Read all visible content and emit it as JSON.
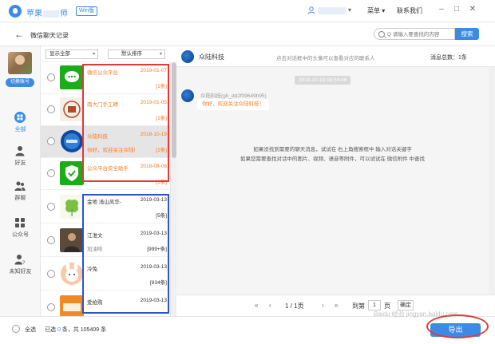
{
  "titlebar": {
    "app_name": "苹果",
    "app_name_suffix": "师",
    "edition": "Win版",
    "user_name": "",
    "menu_label": "菜单 ▾",
    "contact_label": "联系我们",
    "minimize": "–",
    "restore": "□",
    "close": "✕"
  },
  "header": {
    "title": "微信聊天记录",
    "search_placeholder": "Q 请输入要查找的内容",
    "search_button": "搜索"
  },
  "sidebar": {
    "switch_account": "切换账号",
    "items": [
      {
        "label": "全部",
        "icon": "grid-icon"
      },
      {
        "label": "好友",
        "icon": "user-icon"
      },
      {
        "label": "群聊",
        "icon": "group-icon"
      },
      {
        "label": "公众号",
        "icon": "apps-icon"
      },
      {
        "label": "未知好友",
        "icon": "unknown-user-icon"
      }
    ]
  },
  "list": {
    "filter_label": "显示全部",
    "sort_label": "默认排序",
    "rows": [
      {
        "name": "微信公众平台",
        "date": "2019-01-07",
        "sub": "",
        "count": "[1条]",
        "highlight": true
      },
      {
        "name": "南大门手工精",
        "date": "2019-01-05",
        "sub": "",
        "count": "[1条]",
        "highlight": true
      },
      {
        "name": "众陆科技",
        "date": "2018-10-19",
        "sub": "你好，欢迎关注众陆科",
        "count": "[1条]",
        "highlight": true,
        "selected": true
      },
      {
        "name": "公众平台安全助手",
        "date": "2018-08-08",
        "sub": "",
        "count": "[1条]",
        "highlight": true
      },
      {
        "name": "金地 浅山风华-",
        "date": "2019-03-13",
        "sub": "",
        "count": "[5条]",
        "highlight": false
      },
      {
        "name": "江淮文",
        "date": "2019-03-13",
        "sub": "加油哈",
        "count": "[999+条]",
        "highlight": false
      },
      {
        "name": "冷兔",
        "date": "2019-03-13",
        "sub": "",
        "count": "[834条]",
        "highlight": false
      },
      {
        "name": "爱抢购",
        "date": "2019-03-13",
        "sub": "",
        "count": "",
        "highlight": false
      }
    ]
  },
  "chat": {
    "name": "众陆科技",
    "tip": "点击对话框中的头像可以查看对应的联系人",
    "total": "消息总数：1条",
    "time": "2018-10-19 08:54:46",
    "sender": "众陆科技(gh_dd2f09649b95)",
    "message": "你好，欢迎关注众陆科技！",
    "hint1": "如果没找到需要的聊天消息，试试在 右上角搜索框中 输入对话关键字",
    "hint2": "如果您需要查找对话中的图片、视频、语音等附件，可以试试在 微信附件 中查找"
  },
  "pager": {
    "first": "«",
    "prev": "‹",
    "page_info": "1 / 1页",
    "next": "›",
    "last": "»",
    "goto_label": "到第",
    "page_input": "1",
    "page_unit": "页",
    "go_button": "确定"
  },
  "footer": {
    "select_all": "全选",
    "selected_prefix": "已选",
    "selected_count": "0",
    "selected_mid": "条，共",
    "total_count": "105409",
    "selected_suffix": "条",
    "export_button": "导出"
  },
  "watermark": "Baidu 经验 jingyan.baidu.com",
  "colors": {
    "accent": "#3b8be6",
    "highlight_text": "#ff7a1a",
    "red_box": "#e23838",
    "blue_box": "#2d55c6"
  }
}
